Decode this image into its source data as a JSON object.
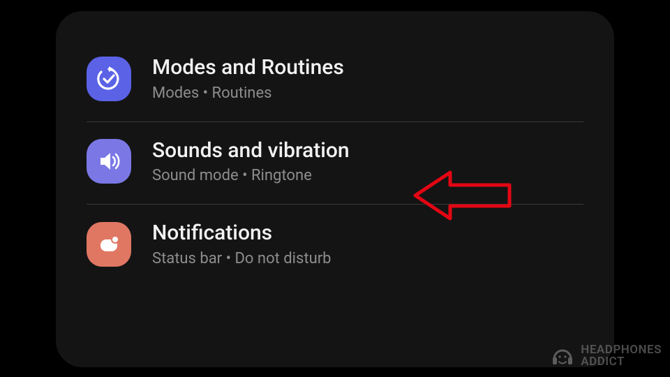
{
  "settings": {
    "items": [
      {
        "title": "Modes and Routines",
        "subtitle": "Modes  •  Routines"
      },
      {
        "title": "Sounds and vibration",
        "subtitle": "Sound mode  •  Ringtone"
      },
      {
        "title": "Notifications",
        "subtitle": "Status bar  •  Do not disturb"
      }
    ]
  },
  "watermark": {
    "line1": "HEADPHONES",
    "line2": "ADDICT"
  },
  "callout": {
    "target": "sounds-and-vibration",
    "color": "#e30613"
  }
}
